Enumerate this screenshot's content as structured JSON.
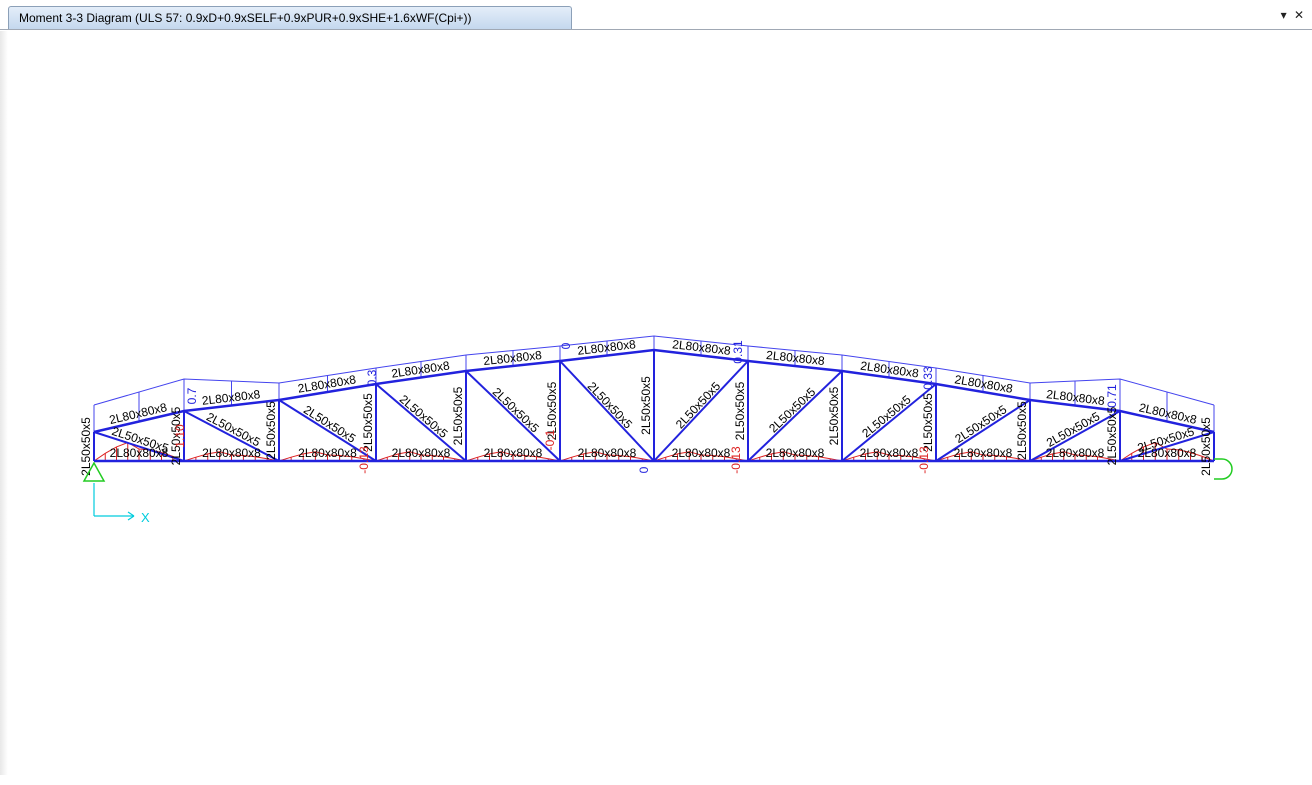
{
  "window": {
    "tab_title": "Moment 3-3 Diagram (ULS 57: 0.9xD+0.9xSELF+0.9xPUR+0.9xSHE+1.6xWF(Cpi+))",
    "dropdown_icon": "▾",
    "close_icon": "✕"
  },
  "colors": {
    "member": "#2222dd",
    "diagram_outline": "#4444ee",
    "moment_negative": "#dd2222",
    "axis": "#00ccdd",
    "support": "#22cc22"
  },
  "axis": {
    "x_label": "X"
  },
  "sections": {
    "top_chord": "2L80x80x8",
    "bottom_chord": "2L80x80x8",
    "web": "2L50x50x5",
    "end_post": "2L50x50x5"
  },
  "moment_values": [
    {
      "text": "0.7"
    },
    {
      "text": "1.10"
    },
    {
      "text": "0.3"
    },
    {
      "text": "0"
    },
    {
      "text": "0.31"
    },
    {
      "text": "0.33"
    },
    {
      "text": "0.71"
    },
    {
      "text": "0"
    },
    {
      "text": "-0.13"
    },
    {
      "text": "-0.1"
    },
    {
      "text": "-0.13"
    },
    {
      "text": "-0.13"
    }
  ],
  "supports": {
    "left": "pinned",
    "right": "roller"
  }
}
